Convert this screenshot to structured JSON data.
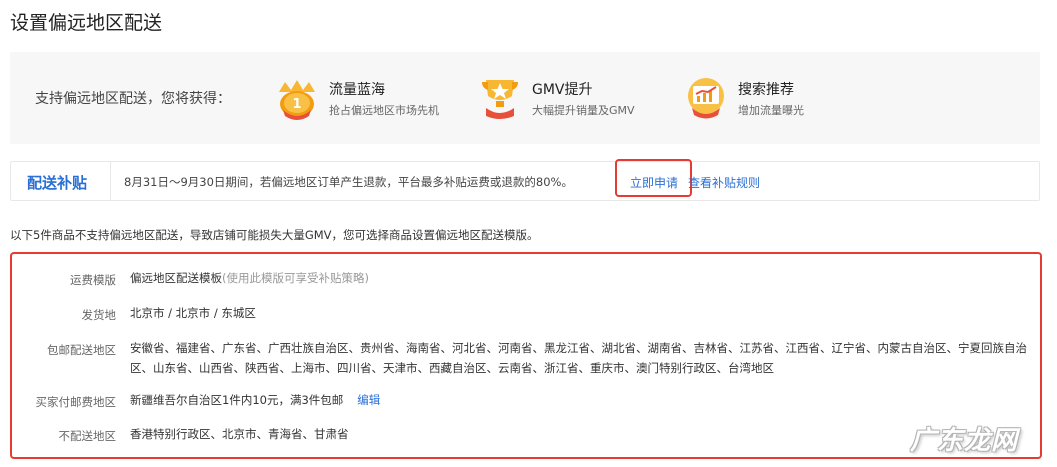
{
  "page": {
    "title": "设置偏远地区配送"
  },
  "benefits": {
    "lead": "支持偏远地区配送，您将获得：",
    "items": [
      {
        "icon": "traffic-medal-icon",
        "title": "流量蓝海",
        "desc": "抢占偏远地区市场先机"
      },
      {
        "icon": "gmv-trophy-icon",
        "title": "GMV提升",
        "desc": "大幅提升销量及GMV"
      },
      {
        "icon": "search-growth-icon",
        "title": "搜索推荐",
        "desc": "增加流量曝光"
      }
    ]
  },
  "subsidy": {
    "title": "配送补贴",
    "text": "8月31日～9月30日期间，若偏远地区订单产生退款，平台最多补贴运费或退款的80%。",
    "apply_label": "立即申请",
    "rules_label": "查看补贴规则"
  },
  "notice": "以下5件商品不支持偏远地区配送，导致店铺可能损失大量GMV，您可选择商品设置偏远地区配送模版。",
  "template": {
    "rows": [
      {
        "label": "运费模版",
        "value": "偏远地区配送模板",
        "hint": "(使用此模版可享受补贴策略)"
      },
      {
        "label": "发货地",
        "value": "北京市 / 北京市 / 东城区"
      },
      {
        "label": "包邮配送地区",
        "value": "安徽省、福建省、广东省、广西壮族自治区、贵州省、海南省、河北省、河南省、黑龙江省、湖北省、湖南省、吉林省、江苏省、江西省、辽宁省、内蒙古自治区、宁夏回族自治区、山东省、山西省、陕西省、上海市、四川省、天津市、西藏自治区、云南省、浙江省、重庆市、澳门特别行政区、台湾地区"
      },
      {
        "label": "买家付邮费地区",
        "value": "新疆维吾尔自治区1件内10元，满3件包邮",
        "edit_label": "编辑"
      },
      {
        "label": "不配送地区",
        "value": "香港特别行政区、北京市、青海省、甘肃省"
      }
    ]
  },
  "watermark": {
    "text": "广东龙网"
  },
  "colors": {
    "accent": "#2a6fd6",
    "highlight": "#e53b30",
    "panel": "#f7f7f8"
  }
}
